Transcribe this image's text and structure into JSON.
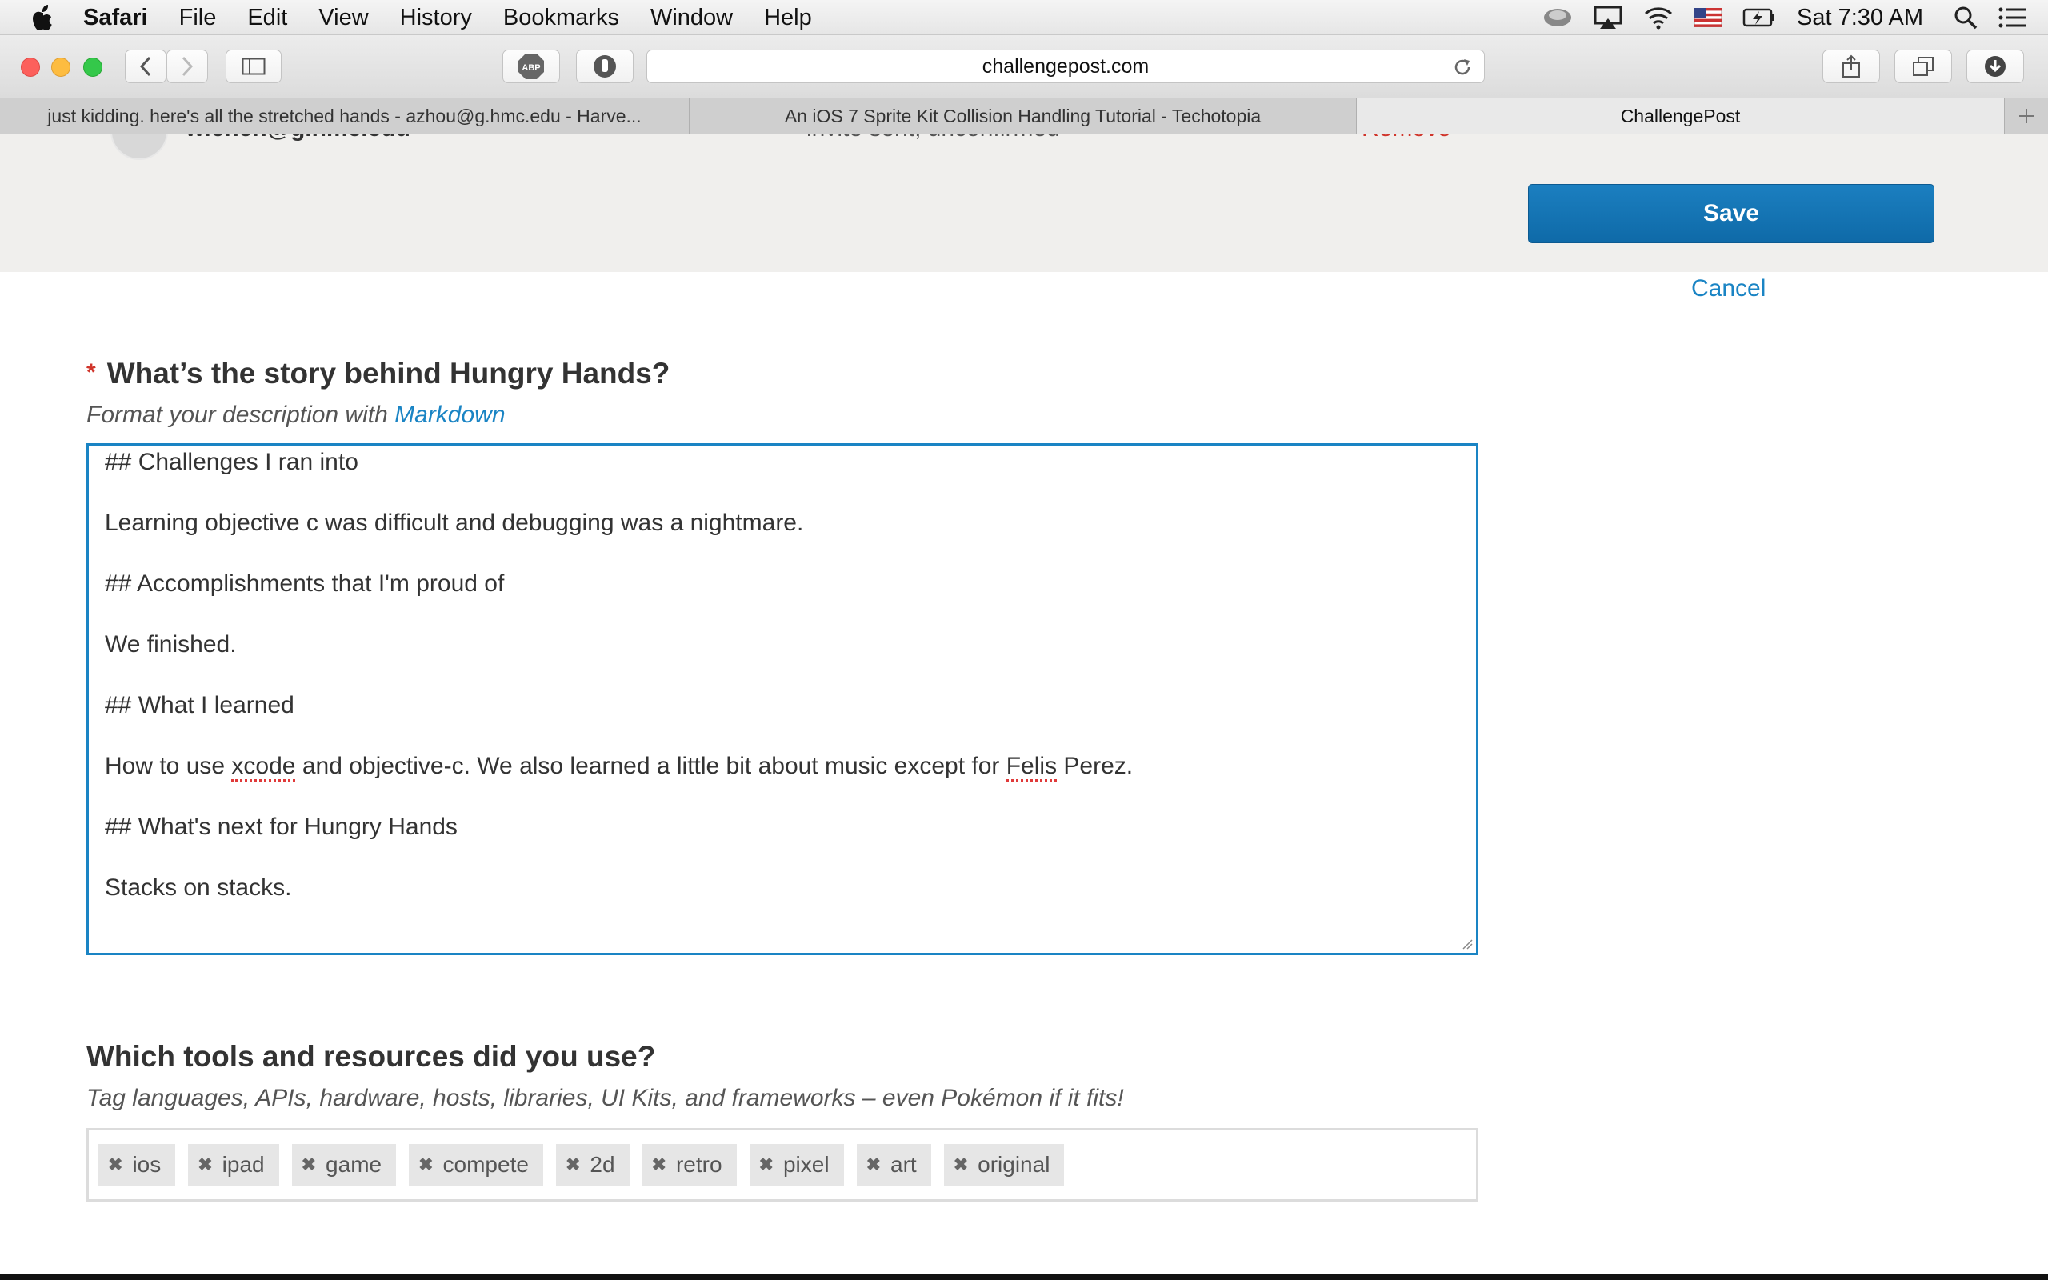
{
  "menubar": {
    "app_name": "Safari",
    "items": [
      "File",
      "Edit",
      "View",
      "History",
      "Bookmarks",
      "Window",
      "Help"
    ],
    "clock": "Sat 7:30 AM"
  },
  "toolbar": {
    "url": "challengepost.com"
  },
  "tabs": [
    {
      "label": "just kidding. here's all the stretched hands - azhou@g.hmc.edu - Harve..."
    },
    {
      "label": "An iOS 7 Sprite Kit Collision Handling Tutorial - Techotopia"
    },
    {
      "label": "ChallengePost"
    }
  ],
  "team": {
    "member_email": "wichen@g.hmc.edu",
    "member_status": "invite sent, unconfirmed",
    "remove_label": "Remove"
  },
  "actions": {
    "save_label": "Save",
    "cancel_label": "Cancel"
  },
  "story": {
    "required_marker": "*",
    "question": "What’s the story behind Hungry Hands?",
    "hint_prefix": "Format your description with ",
    "hint_link": "Markdown",
    "lines": [
      "## Challenges I ran into",
      "Learning objective c was difficult and debugging was a nightmare.",
      "## Accomplishments that I'm proud of",
      "We finished.",
      "## What I learned",
      "## What's next for Hungry Hands",
      "Stacks on stacks."
    ],
    "learned_line": {
      "part1": "How to use ",
      "word1": "xcode",
      "part2": " and objective-c. We also learned a little bit about music except for ",
      "word2": "Felis",
      "part3": " Perez."
    }
  },
  "tools": {
    "question": "Which tools and resources did you use?",
    "hint": "Tag languages, APIs, hardware, hosts, libraries, UI Kits, and frameworks – even Pokémon if it fits!",
    "remove_glyph": "✖",
    "tags": [
      "ios",
      "ipad",
      "game",
      "compete",
      "2d",
      "retro",
      "pixel",
      "art",
      "original"
    ]
  }
}
